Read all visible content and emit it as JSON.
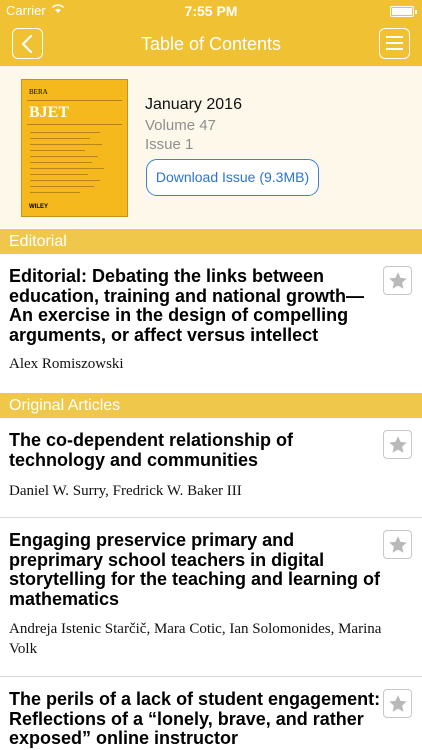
{
  "status_bar": {
    "carrier": "Carrier",
    "time": "7:55 PM"
  },
  "nav": {
    "title": "Table of Contents",
    "back_icon": "chevron-left-icon",
    "menu_icon": "hamburger-icon"
  },
  "issue": {
    "cover": {
      "publisher_mark": "BERA",
      "journal_abbrev": "BJET",
      "journal_name": "British Journal of Educational Technology",
      "imprint": "WILEY"
    },
    "date": "January 2016",
    "volume": "Volume 47",
    "number": "Issue 1",
    "download_label": "Download Issue (9.3MB)"
  },
  "sections": [
    {
      "title": "Editorial",
      "articles": [
        {
          "title": "Editorial: Debating the links between education, training and national growth—An exercise in the design of compelling arguments, or affect versus intellect",
          "authors": "Alex Romiszowski"
        }
      ]
    },
    {
      "title": "Original Articles",
      "articles": [
        {
          "title": "The co-dependent relationship of technology and communities",
          "authors": "Daniel W. Surry, Fredrick W. Baker III"
        },
        {
          "title": "Engaging preservice primary and preprimary school teachers in digital storytelling for the teaching and learning of mathematics",
          "authors": "Andreja Istenic Starčič, Mara Cotic, Ian Solomonides, Marina Volk"
        },
        {
          "title": "The perils of a lack of student engagement: Reflections of a “lonely, brave, and rather exposed” online instructor",
          "authors": ""
        }
      ]
    }
  ],
  "colors": {
    "accent": "#f0c132",
    "section_header": "#efc84b",
    "issue_background": "#fdf8e9",
    "link_blue": "#2b73d6"
  }
}
